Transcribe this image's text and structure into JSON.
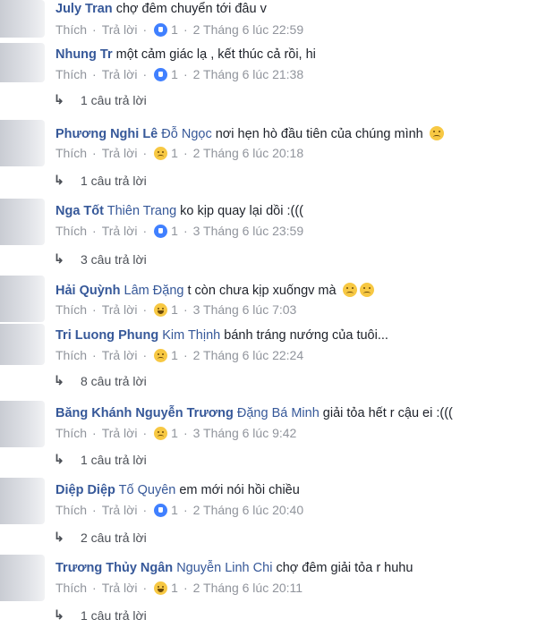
{
  "comments": [
    {
      "name": "July Tran",
      "tag": "",
      "text": "chợ đêm chuyển tới đâu v",
      "emoji": 0,
      "like": "Thích",
      "reply": "Trả lời",
      "reaction": "like",
      "count": "1",
      "date": "2 Tháng 6 lúc 22:59"
    },
    {
      "name": "Nhung Tr",
      "tag": "",
      "text": "một cảm giác lạ , kết thúc cả rồi, hi",
      "emoji": 0,
      "like": "Thích",
      "reply": "Trả lời",
      "reaction": "like",
      "count": "1",
      "date": "2 Tháng 6 lúc 21:38"
    },
    {
      "name": "Phương Nghi Lê",
      "tag": "Đỗ Ngọc",
      "text": "nơi hẹn hò đầu tiên của chúng mình",
      "emoji": 1,
      "like": "Thích",
      "reply": "Trả lời",
      "reaction": "sad",
      "count": "1",
      "date": "2 Tháng 6 lúc 20:18"
    },
    {
      "name": "Nga Tốt",
      "tag": "Thiên Trang",
      "text": "ko kịp quay lại dồi :(((",
      "emoji": 0,
      "like": "Thích",
      "reply": "Trả lời",
      "reaction": "like",
      "count": "1",
      "date": "3 Tháng 6 lúc 23:59"
    },
    {
      "name": "Hải Quỳnh",
      "tag": "Lâm Đặng",
      "text": "t còn chưa kịp xuốngv mà",
      "emoji": 2,
      "like": "Thích",
      "reply": "Trả lời",
      "reaction": "haha",
      "count": "1",
      "date": "3 Tháng 6 lúc 7:03"
    },
    {
      "name": "Tri Luong Phung",
      "tag": "Kim Thịnh",
      "text": "bánh tráng nướng của tuôi...",
      "emoji": 0,
      "like": "Thích",
      "reply": "Trả lời",
      "reaction": "sad",
      "count": "1",
      "date": "2 Tháng 6 lúc 22:24"
    },
    {
      "name": "Băng Khánh Nguyễn Trương",
      "tag": "Đặng Bá Minh",
      "text": "giải tỏa hết r cậu ei :(((",
      "emoji": 0,
      "like": "Thích",
      "reply": "Trả lời",
      "reaction": "sad",
      "count": "1",
      "date": "3 Tháng 6 lúc 9:42"
    },
    {
      "name": "Diệp Diệp",
      "tag": "Tố Quyên",
      "text": "em mới nói hồi chiều",
      "emoji": 0,
      "like": "Thích",
      "reply": "Trả lời",
      "reaction": "like",
      "count": "1",
      "date": "2 Tháng 6 lúc 20:40"
    },
    {
      "name": "Trương Thủy Ngân",
      "tag": "Nguyễn Linh Chi",
      "text": "chợ đêm giải tỏa r huhu",
      "emoji": 0,
      "like": "Thích",
      "reply": "Trả lời",
      "reaction": "haha",
      "count": "1",
      "date": "2 Tháng 6 lúc 20:11"
    }
  ],
  "replies": [
    {
      "label": "1 câu trả lời"
    },
    {
      "label": "1 câu trả lời"
    },
    {
      "label": "3 câu trả lời"
    },
    {
      "label": "8 câu trả lời"
    },
    {
      "label": "1 câu trả lời"
    },
    {
      "label": "2 câu trả lời"
    },
    {
      "label": "1 câu trả lời"
    }
  ],
  "icons": {
    "reply_arrow": "reply-arrow-icon",
    "like": "like-reaction-icon",
    "sad": "sad-reaction-icon",
    "haha": "haha-reaction-icon"
  },
  "colors": {
    "name": "#365899",
    "meta": "#90949c",
    "like": "#4080ff",
    "emoji": "#f7c843"
  }
}
